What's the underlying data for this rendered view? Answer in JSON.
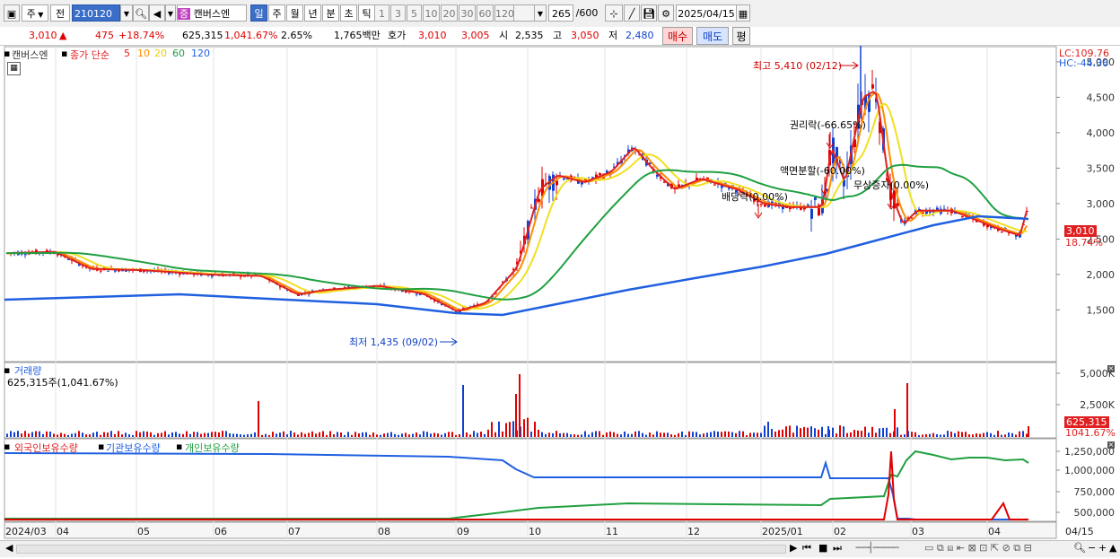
{
  "toolbar": {
    "period_unit": "주",
    "market": "전",
    "code": "210120",
    "stock_badge": "증",
    "stock_name": "캔버스엔",
    "periods": [
      "일",
      "주",
      "월",
      "년",
      "분",
      "초",
      "틱"
    ],
    "active_period": "일",
    "minutes": [
      "1",
      "3",
      "5",
      "10",
      "20",
      "30",
      "60",
      "120"
    ],
    "count": "265",
    "count_total": "/600",
    "date": "2025/04/15"
  },
  "quote": {
    "price": "3,010",
    "change_arrow": "▲",
    "change": "475",
    "change_pct": "+18.74%",
    "volume": "625,315",
    "volume_ratio": "1,041.67%",
    "turnover": "2.65%",
    "amount": "1,765백만",
    "ask_label": "호가",
    "ask": "3,010",
    "bid": "3,005",
    "open_label": "시",
    "open": "2,535",
    "high_label": "고",
    "high": "3,050",
    "low_label": "저",
    "low": "2,480",
    "buy": "매수",
    "sell": "매도",
    "eval": "평"
  },
  "price_panel": {
    "name": "캔버스엔",
    "ma_title": "종가 단순",
    "ma_periods": [
      "5",
      "10",
      "20",
      "60",
      "120"
    ],
    "lc": "LC:109.76",
    "hc": "HC:-44.36",
    "y_ticks": [
      "5,000",
      "4,500",
      "4,000",
      "3,500",
      "3,000",
      "2,500",
      "2,000",
      "1,500"
    ],
    "last_price": "3,010",
    "last_pct": "18.74%",
    "annotations": {
      "high": "최고 5,410 (02/12)",
      "low": "최저 1,435 (09/02)",
      "rights": "권리락(-66.65%)",
      "split": "액면분할(-60.00%)",
      "dividend": "배당락(0.00%)",
      "bonus": "무상증자(0.00%)"
    }
  },
  "volume_panel": {
    "title": "거래량",
    "value": "625,315주(1,041.67%)",
    "y_ticks": [
      "5,000K",
      "2,500K"
    ],
    "last": "625,315",
    "last_pct": "1041.67%"
  },
  "holdings_panel": {
    "foreign": "외국인보유수량",
    "institution": "기관보유수량",
    "individual": "개인보유수량",
    "y_ticks": [
      "1,250,000",
      "1,000,000",
      "750,000",
      "500,000"
    ]
  },
  "x_axis": [
    "2024/03",
    "04",
    "05",
    "06",
    "07",
    "08",
    "09",
    "10",
    "11",
    "12",
    "2025/01",
    "02",
    "03",
    "04",
    "04/15"
  ],
  "colors": {
    "ma5": "#e02020",
    "ma10": "#ff8c00",
    "ma20": "#f0e020",
    "ma60": "#20a040",
    "ma120": "#2060e0",
    "up": "#e00000",
    "down": "#1040d0"
  }
}
